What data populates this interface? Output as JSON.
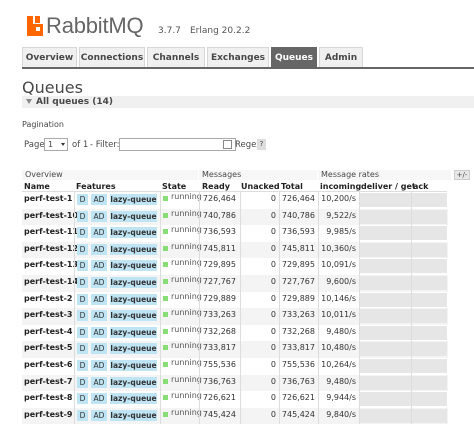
{
  "app": {
    "name": "RabbitMQ",
    "version": "3.7.7",
    "erlang": "Erlang 20.2.2"
  },
  "nav": {
    "tabs": [
      "Overview",
      "Connections",
      "Channels",
      "Exchanges",
      "Queues",
      "Admin"
    ],
    "active": "Queues"
  },
  "page": {
    "title": "Queues",
    "section": "All queues (14)",
    "pagination_label": "Pagination",
    "page_label": "Page",
    "page_value": "1",
    "of_label": "of 1",
    "filter_label": "- Filter:",
    "filter_value": "",
    "regex_label": "Regex",
    "help": "?"
  },
  "table": {
    "groups": {
      "overview": "Overview",
      "messages": "Messages",
      "rates": "Message rates",
      "toggle": "+/-"
    },
    "columns": {
      "name": "Name",
      "features": "Features",
      "state": "State",
      "ready": "Ready",
      "unacked": "Unacked",
      "total": "Total",
      "incoming": "incoming",
      "deliver": "deliver / get",
      "ack": "ack"
    },
    "rows": [
      {
        "name": "perf-test-1",
        "f1": "D",
        "f2": "AD",
        "f3": "lazy-queue",
        "state": "running",
        "ready": "726,464",
        "unacked": "0",
        "total": "726,464",
        "incoming": "10,200/s"
      },
      {
        "name": "perf-test-10",
        "f1": "D",
        "f2": "AD",
        "f3": "lazy-queue",
        "state": "running",
        "ready": "740,786",
        "unacked": "0",
        "total": "740,786",
        "incoming": "9,522/s"
      },
      {
        "name": "perf-test-11",
        "f1": "D",
        "f2": "AD",
        "f3": "lazy-queue",
        "state": "running",
        "ready": "736,593",
        "unacked": "0",
        "total": "736,593",
        "incoming": "9,985/s"
      },
      {
        "name": "perf-test-12",
        "f1": "D",
        "f2": "AD",
        "f3": "lazy-queue",
        "state": "running",
        "ready": "745,811",
        "unacked": "0",
        "total": "745,811",
        "incoming": "10,360/s"
      },
      {
        "name": "perf-test-13",
        "f1": "D",
        "f2": "AD",
        "f3": "lazy-queue",
        "state": "running",
        "ready": "729,895",
        "unacked": "0",
        "total": "729,895",
        "incoming": "10,091/s"
      },
      {
        "name": "perf-test-14",
        "f1": "D",
        "f2": "AD",
        "f3": "lazy-queue",
        "state": "running",
        "ready": "727,767",
        "unacked": "0",
        "total": "727,767",
        "incoming": "9,600/s"
      },
      {
        "name": "perf-test-2",
        "f1": "D",
        "f2": "AD",
        "f3": "lazy-queue",
        "state": "running",
        "ready": "729,889",
        "unacked": "0",
        "total": "729,889",
        "incoming": "10,146/s"
      },
      {
        "name": "perf-test-3",
        "f1": "D",
        "f2": "AD",
        "f3": "lazy-queue",
        "state": "running",
        "ready": "733,263",
        "unacked": "0",
        "total": "733,263",
        "incoming": "10,011/s"
      },
      {
        "name": "perf-test-4",
        "f1": "D",
        "f2": "AD",
        "f3": "lazy-queue",
        "state": "running",
        "ready": "732,268",
        "unacked": "0",
        "total": "732,268",
        "incoming": "9,480/s"
      },
      {
        "name": "perf-test-5",
        "f1": "D",
        "f2": "AD",
        "f3": "lazy-queue",
        "state": "running",
        "ready": "733,817",
        "unacked": "0",
        "total": "733,817",
        "incoming": "10,480/s"
      },
      {
        "name": "perf-test-6",
        "f1": "D",
        "f2": "AD",
        "f3": "lazy-queue",
        "state": "running",
        "ready": "755,536",
        "unacked": "0",
        "total": "755,536",
        "incoming": "10,264/s"
      },
      {
        "name": "perf-test-7",
        "f1": "D",
        "f2": "AD",
        "f3": "lazy-queue",
        "state": "running",
        "ready": "736,763",
        "unacked": "0",
        "total": "736,763",
        "incoming": "9,480/s"
      },
      {
        "name": "perf-test-8",
        "f1": "D",
        "f2": "AD",
        "f3": "lazy-queue",
        "state": "running",
        "ready": "726,621",
        "unacked": "0",
        "total": "726,621",
        "incoming": "9,944/s"
      },
      {
        "name": "perf-test-9",
        "f1": "D",
        "f2": "AD",
        "f3": "lazy-queue",
        "state": "running",
        "ready": "745,424",
        "unacked": "0",
        "total": "745,424",
        "incoming": "9,840/s"
      }
    ]
  },
  "colors": {
    "brand": "#ff6600",
    "nav_active": "#666666",
    "feature_badge": "#bfe5f5",
    "running": "#88dd77"
  }
}
